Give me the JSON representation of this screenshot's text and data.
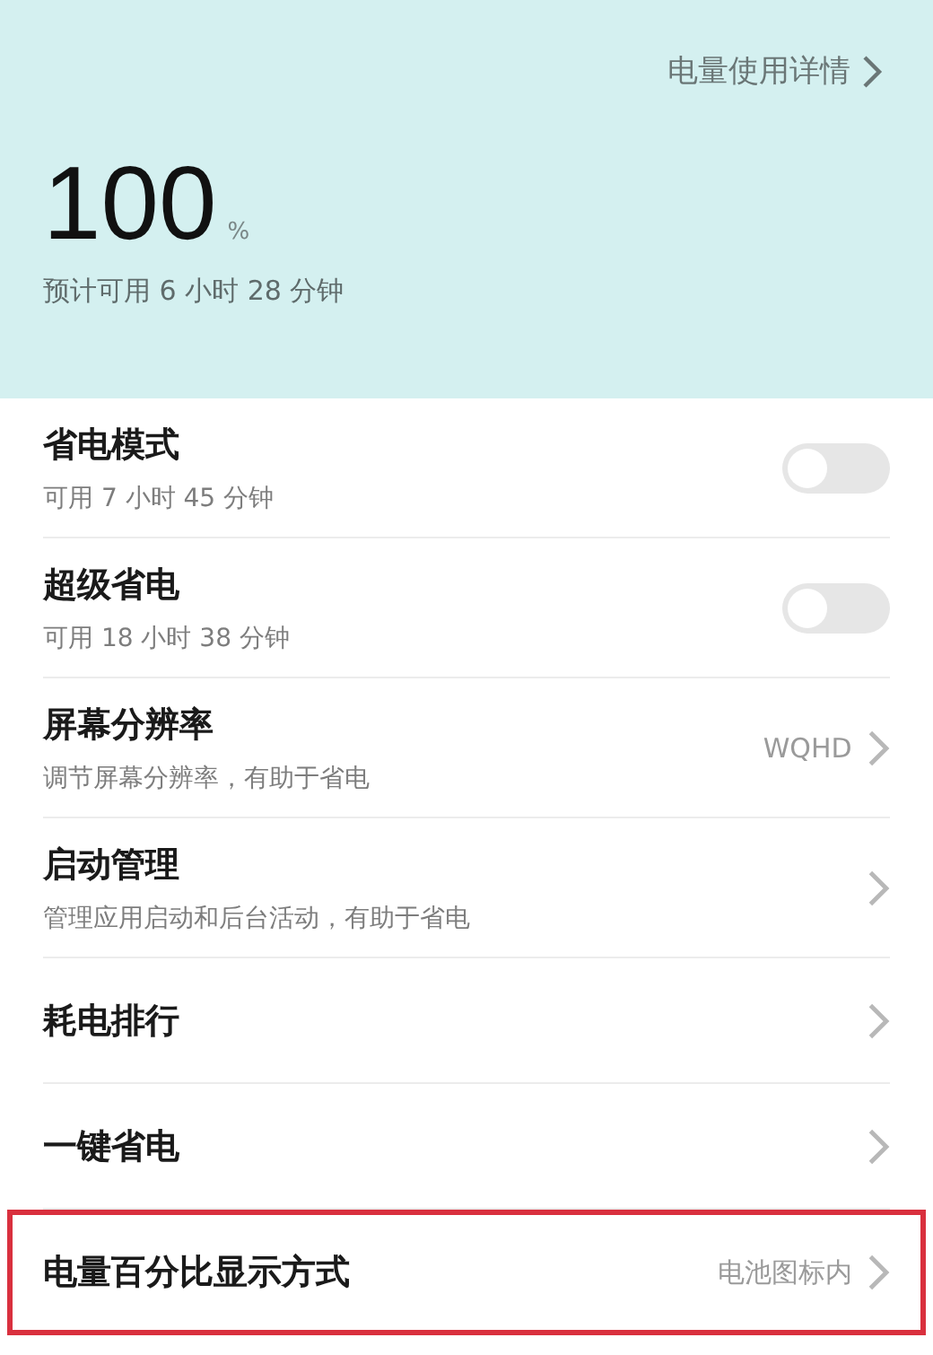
{
  "summary": {
    "details_link": "电量使用详情",
    "percent": "100",
    "percent_unit": "%",
    "estimate": "预计可用 6 小时 28 分钟"
  },
  "settings": [
    {
      "kind": "toggle",
      "title": "省电模式",
      "subtitle": "可用 7 小时 45 分钟",
      "on": false,
      "highlighted": false
    },
    {
      "kind": "toggle",
      "title": "超级省电",
      "subtitle": "可用 18 小时 38 分钟",
      "on": false,
      "highlighted": false
    },
    {
      "kind": "link",
      "title": "屏幕分辨率",
      "subtitle": "调节屏幕分辨率，有助于省电",
      "value": "WQHD",
      "highlighted": false
    },
    {
      "kind": "link",
      "title": "启动管理",
      "subtitle": "管理应用启动和后台活动，有助于省电",
      "highlighted": false
    },
    {
      "kind": "link",
      "title": "耗电排行",
      "highlighted": false
    },
    {
      "kind": "link",
      "title": "一键省电",
      "highlighted": false
    },
    {
      "kind": "link",
      "title": "电量百分比显示方式",
      "value": "电池图标内",
      "highlighted": true
    }
  ]
}
